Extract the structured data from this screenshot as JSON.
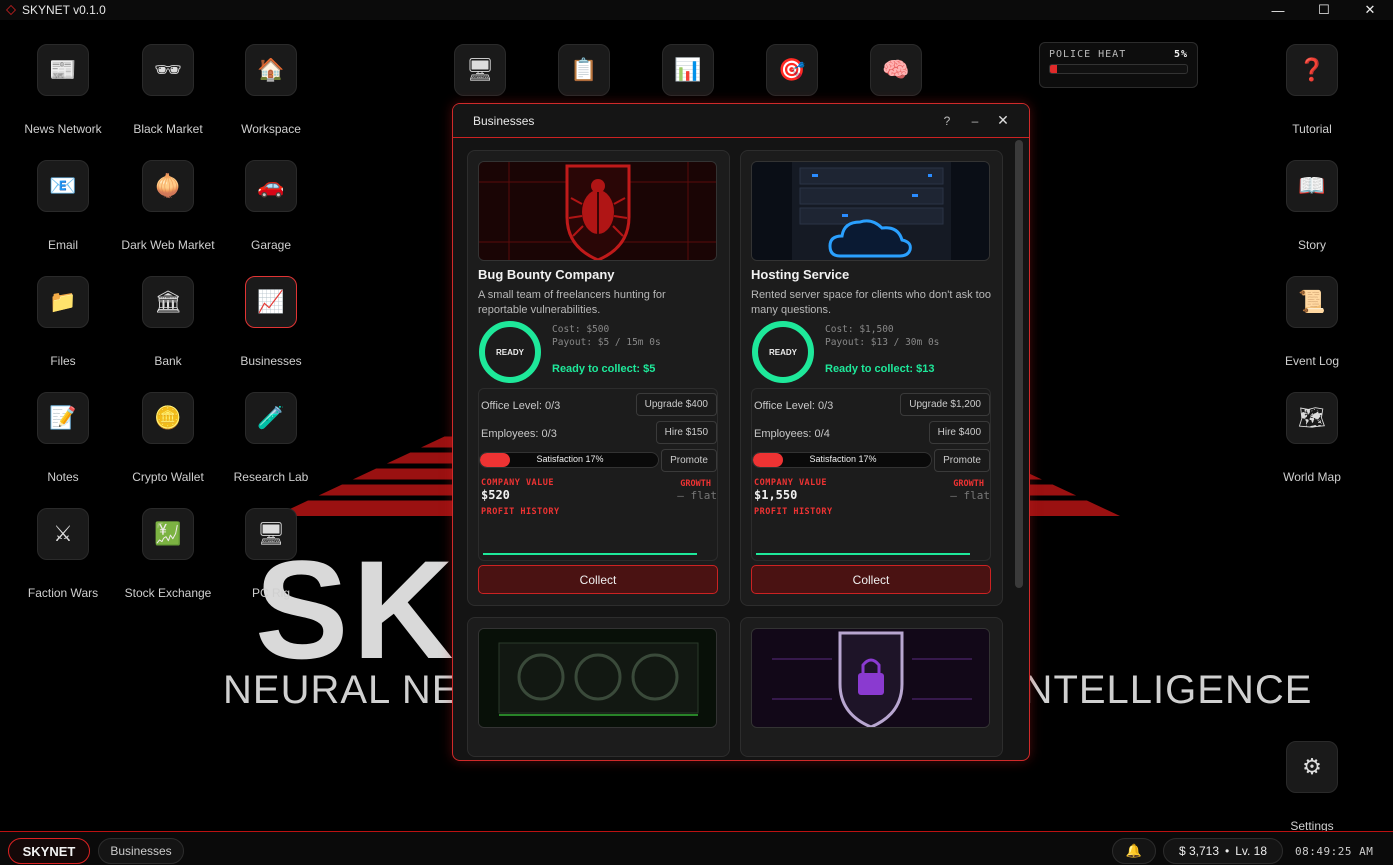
{
  "window": {
    "title": "SKYNET v0.1.0"
  },
  "wallpaper": {
    "big_text": "SKYNET",
    "sub_text": "NEURAL NETWORK BASED ARTIFICIAL INTELLIGENCE"
  },
  "desktop": {
    "left_icons": [
      {
        "label": "News Network",
        "icon": "newspaper-icon",
        "glyph": "📰"
      },
      {
        "label": "Black Market",
        "icon": "mask-icon",
        "glyph": "🕶"
      },
      {
        "label": "Workspace",
        "icon": "house-icon",
        "glyph": "🏠"
      },
      {
        "label": "Email",
        "icon": "email-icon",
        "glyph": "📧"
      },
      {
        "label": "Dark Web Market",
        "icon": "onion-icon",
        "glyph": "🧅"
      },
      {
        "label": "Garage",
        "icon": "car-icon",
        "glyph": "🚗"
      },
      {
        "label": "Files",
        "icon": "folder-icon",
        "glyph": "📁"
      },
      {
        "label": "Bank",
        "icon": "bank-icon",
        "glyph": "🏛"
      },
      {
        "label": "Businesses",
        "icon": "chart-up-icon",
        "glyph": "📈"
      },
      {
        "label": "Notes",
        "icon": "memo-icon",
        "glyph": "📝"
      },
      {
        "label": "Crypto Wallet",
        "icon": "coin-icon",
        "glyph": "🪙"
      },
      {
        "label": "Research Lab",
        "icon": "test-tube-icon",
        "glyph": "🧪"
      },
      {
        "label": "Faction Wars",
        "icon": "swords-icon",
        "glyph": "⚔"
      },
      {
        "label": "Stock Exchange",
        "icon": "stock-chart-icon",
        "glyph": "💹"
      },
      {
        "label": "PC Rig",
        "icon": "computer-icon",
        "glyph": "🖥"
      }
    ],
    "top_icons": [
      {
        "icon": "computer-icon",
        "glyph": "🖥"
      },
      {
        "icon": "clipboard-icon",
        "glyph": "📋"
      },
      {
        "icon": "bar-chart-icon",
        "glyph": "📊"
      },
      {
        "icon": "target-icon",
        "glyph": "🎯"
      },
      {
        "icon": "brain-icon",
        "glyph": "🧠"
      }
    ],
    "right_icons": [
      {
        "label": "Tutorial",
        "icon": "question-icon",
        "glyph": "❓"
      },
      {
        "label": "Story",
        "icon": "book-icon",
        "glyph": "📖"
      },
      {
        "label": "Event Log",
        "icon": "scroll-icon",
        "glyph": "📜"
      },
      {
        "label": "World Map",
        "icon": "map-icon",
        "glyph": "🗺"
      },
      {
        "label": "Settings",
        "icon": "gear-icon",
        "glyph": "⚙"
      }
    ]
  },
  "police_heat": {
    "label": "POLICE HEAT",
    "percent_text": "5%",
    "level": 0.05
  },
  "businesses_window": {
    "title": "Businesses",
    "help": "?",
    "minimize": "–",
    "close": "✕",
    "cards": [
      {
        "name": "Bug Bounty Company",
        "description": "A small team of freelancers hunting for reportable vulnerabilities.",
        "ring_text": "READY",
        "cost": "Cost: $500",
        "payout": "Payout: $5 / 15m 0s",
        "ready": "Ready to collect: $5",
        "office": "Office Level: 0/3",
        "upgrade_btn": "Upgrade $400",
        "employees": "Employees: 0/3",
        "hire_btn": "Hire $150",
        "satisfaction": "Satisfaction 17%",
        "satisfaction_level": 0.17,
        "promote_btn": "Promote",
        "company_value_label": "COMPANY VALUE",
        "company_value": "$520",
        "growth_label": "GROWTH",
        "growth_value": "— flat",
        "profit_history_label": "PROFIT HISTORY",
        "collect_btn": "Collect"
      },
      {
        "name": "Hosting Service",
        "description": "Rented server space for clients who don't ask too many questions.",
        "ring_text": "READY",
        "cost": "Cost: $1,500",
        "payout": "Payout: $13 / 30m 0s",
        "ready": "Ready to collect: $13",
        "office": "Office Level: 0/3",
        "upgrade_btn": "Upgrade $1,200",
        "employees": "Employees: 0/4",
        "hire_btn": "Hire $400",
        "satisfaction": "Satisfaction 17%",
        "satisfaction_level": 0.17,
        "promote_btn": "Promote",
        "company_value_label": "COMPANY VALUE",
        "company_value": "$1,550",
        "growth_label": "GROWTH",
        "growth_value": "— flat",
        "profit_history_label": "PROFIT HISTORY",
        "collect_btn": "Collect"
      }
    ]
  },
  "taskbar": {
    "start": "SKYNET",
    "task": "Businesses",
    "money": "$ 3,713",
    "level": "Lv. 18",
    "clock": "08:49:25 AM"
  },
  "colors": {
    "accent": "#d02a2a",
    "ready": "#1ee89a",
    "background": "#000000"
  }
}
